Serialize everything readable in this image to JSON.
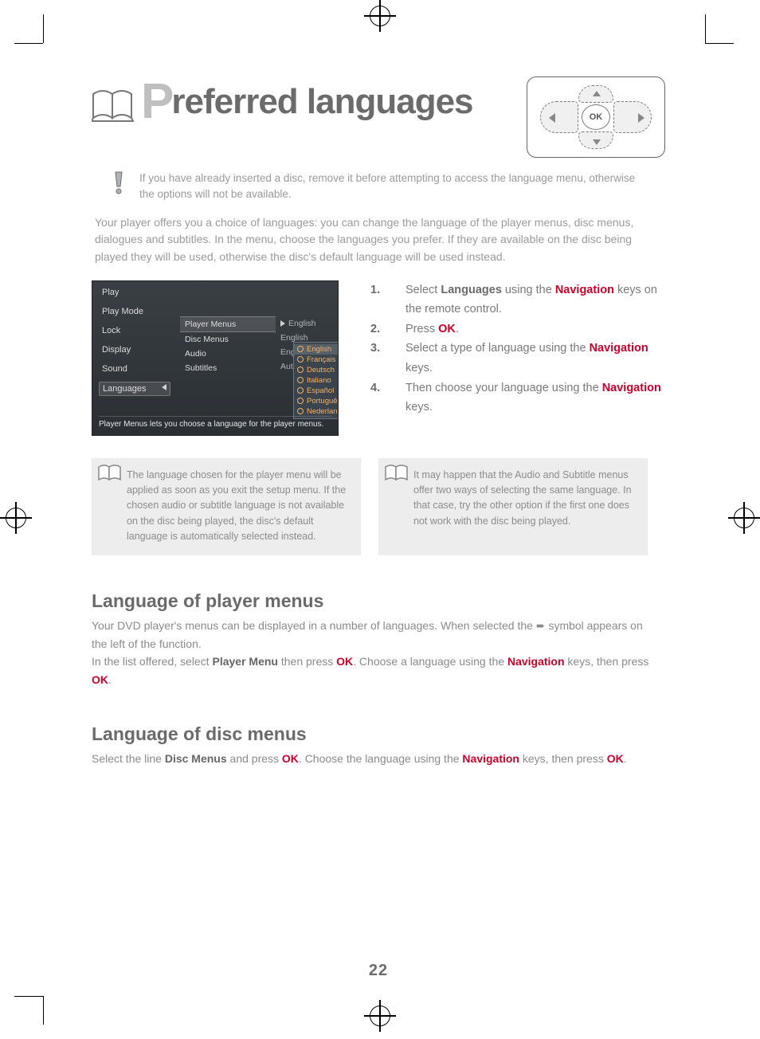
{
  "title": {
    "big": "P",
    "rest": "referred languages"
  },
  "dpad": {
    "ok": "OK"
  },
  "warn_icon_name": "exclamation-icon",
  "warn_text": "If you have already inserted a disc, remove it before attempting to access the language menu, otherwise the options will not be available.",
  "limit_text": "Your player offers you a choice of languages: you can change the language of the player menus, disc menus, dialogues and subtitles. In the menu, choose the languages you prefer. If they are available on the disc being played they will be used, otherwise the disc's default language will be used instead.",
  "screenshot": {
    "left_items": [
      "Play",
      "Play Mode",
      "Lock",
      "Display",
      "Sound",
      "Languages"
    ],
    "left_selected_index": 5,
    "mid_rows": [
      {
        "label": "Player Menus",
        "value": "English",
        "selected": true
      },
      {
        "label": "Disc Menus",
        "value": "English"
      },
      {
        "label": "Audio",
        "value": "English"
      },
      {
        "label": "Subtitles",
        "value": "Auto."
      }
    ],
    "lang_options": [
      "English",
      "Français",
      "Deutsch",
      "Italiano",
      "Español",
      "Português",
      "Nederlands"
    ],
    "lang_selected_index": 0,
    "hint": "Player Menus lets you choose a language for the player menus."
  },
  "steps": {
    "s1": {
      "num": "1.",
      "pre": "Select ",
      "b1": "Languages",
      "mid": " using the ",
      "r": "Navigation",
      "post": " keys on the remote control."
    },
    "s2": {
      "num": "2.",
      "pre": "Press ",
      "r": "OK",
      "post": "."
    },
    "s3": {
      "num": "3.",
      "txt": "Select a type of language using the ",
      "r": "Navigation",
      "post": " keys."
    },
    "s4": {
      "num": "4.",
      "txt": "Then choose your language using the ",
      "r": "Navigation",
      "post": " keys."
    }
  },
  "notes": {
    "left": "The language chosen for the player menu will be applied as soon as you exit the setup menu. If the chosen audio or subtitle language is not available on the disc being played, the disc's default language is automatically selected instead.",
    "right": "It may happen that the Audio and Subtitle menus offer two ways of selecting the same language. In that case, try the other option if the first one does not work with the disc being played."
  },
  "sec_player": {
    "h": "Language of player menus",
    "p": "Your DVD player's menus can be displayed in a number of languages.",
    "arrow_note": "When selected the ➨ symbol appears on the left of the function.",
    "list": {
      "pre": "In the list offered, select ",
      "b": "Player  Menu",
      "mid": " then press ",
      "r1": "OK",
      "post1": ". Choose a language using the ",
      "r2": "Navigation",
      "post2": " keys, then press ",
      "r3": "OK",
      "post3": "."
    }
  },
  "sec_disc": {
    "h": "Language of disc menus",
    "p": {
      "pre": "Select the line ",
      "b": "Disc Menus",
      "mid": " and press ",
      "r1": "OK",
      "post1": ". Choose the language using the ",
      "r2": "Navigation",
      "post2": " keys, then press ",
      "r3": "OK",
      "post3": "."
    }
  },
  "page_number": "22"
}
